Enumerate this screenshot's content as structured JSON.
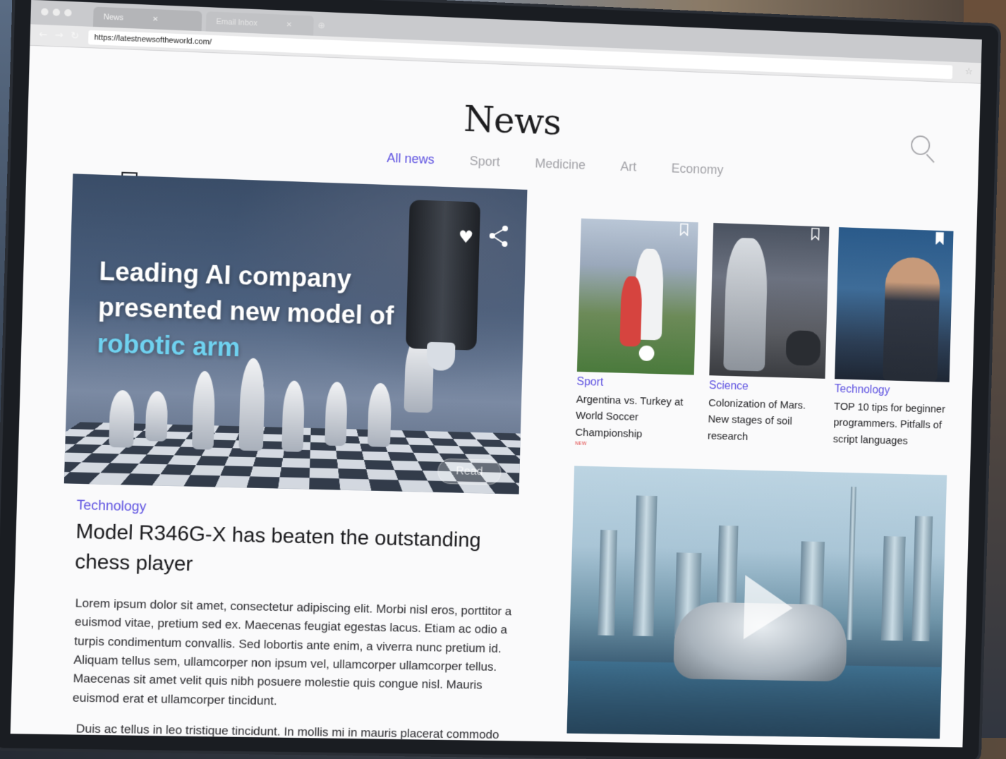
{
  "browser": {
    "tabs": [
      {
        "label": "News",
        "active": true
      },
      {
        "label": "Email Inbox",
        "active": false
      }
    ],
    "url": "https://latestnewsoftheworld.com/"
  },
  "site": {
    "title": "News"
  },
  "categories": [
    {
      "label": "All news",
      "active": true
    },
    {
      "label": "Sport",
      "active": false
    },
    {
      "label": "Medicine",
      "active": false
    },
    {
      "label": "Art",
      "active": false
    },
    {
      "label": "Economy",
      "active": false
    }
  ],
  "hero": {
    "title_line1": "Leading AI company",
    "title_line2": "presented new model of",
    "title_highlight": "robotic arm",
    "read_label": "Read"
  },
  "main_article": {
    "category": "Technology",
    "title": "Model R346G-X has beaten the outstanding chess player",
    "body": "Lorem ipsum dolor sit amet, consectetur adipiscing elit. Morbi nisl eros, porttitor a euismod vitae, pretium sed ex. Maecenas feugiat egestas lacus. Etiam ac odio a turpis condimentum convallis. Sed lobortis ante enim, a viverra nunc pretium id. Aliquam tellus sem, ullamcorper non ipsum vel, ullamcorper ullamcorper tellus. Maecenas sit amet velit quis nibh posuere molestie quis congue nisl. Mauris euismod erat et ullamcorper tincidunt.",
    "body2": "Duis ac tellus in leo tristique tincidunt. In mollis mi in mauris placerat commodo"
  },
  "cards": [
    {
      "category": "Sport",
      "title": "Argentina vs. Turkey at World Soccer Championship",
      "badge": "NEW"
    },
    {
      "category": "Science",
      "title": "Colonization of Mars. New stages of soil research"
    },
    {
      "category": "Technology",
      "title": "TOP 10 tips for beginner programmers. Pitfalls of script languages"
    }
  ],
  "colors": {
    "accent": "#5b4fe0",
    "highlight": "#6fd2f0"
  }
}
